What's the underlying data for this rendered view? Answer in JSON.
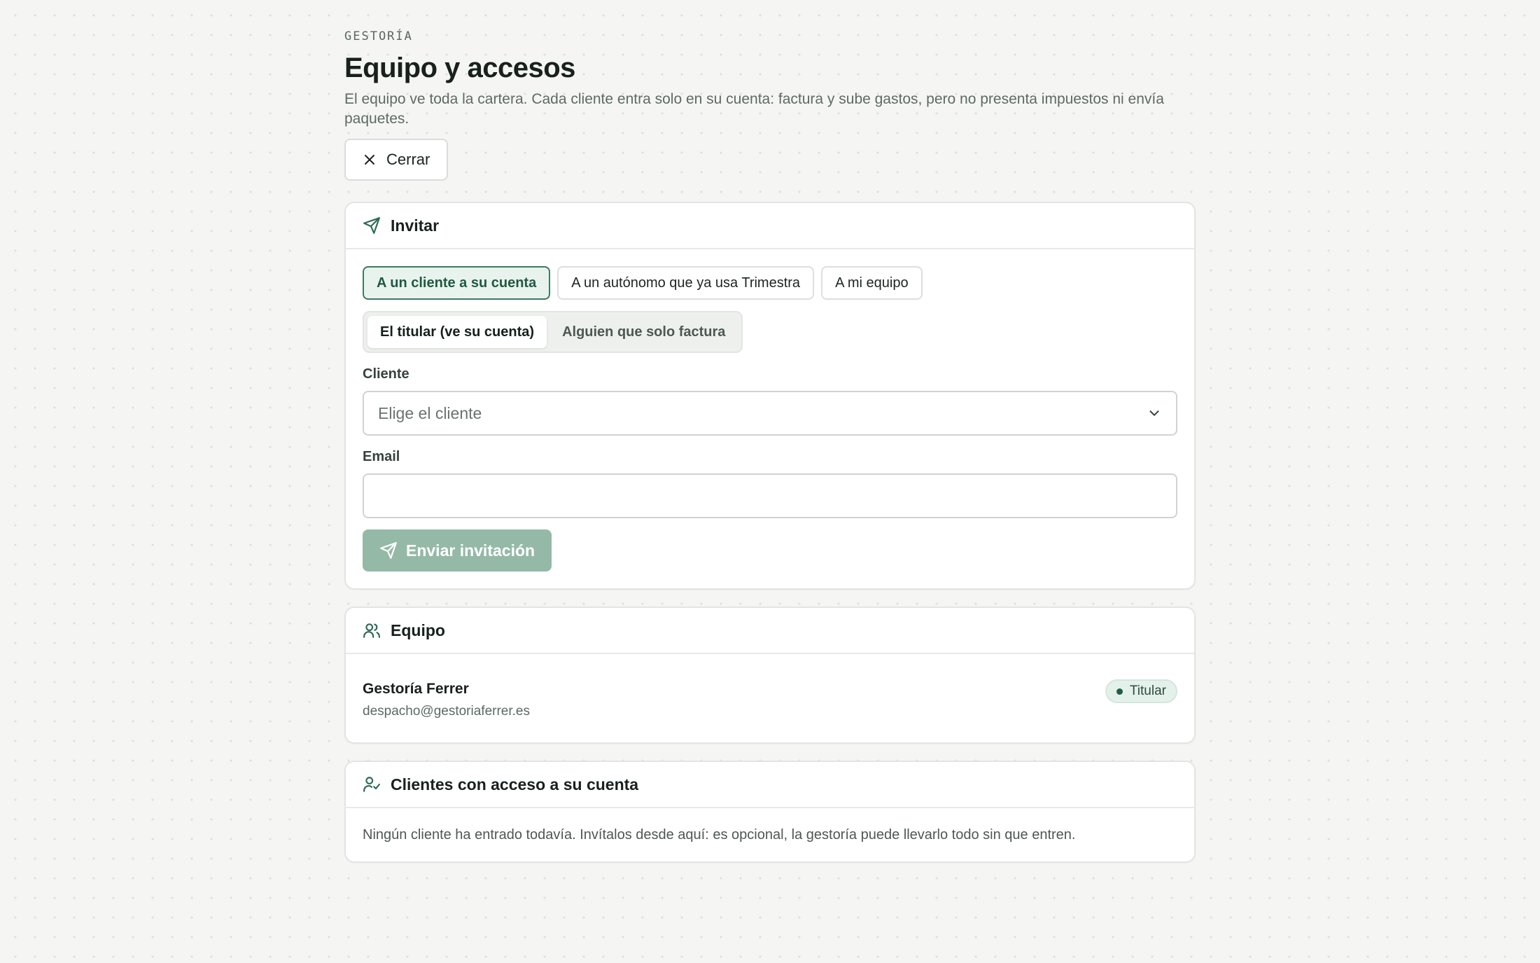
{
  "header": {
    "eyebrow": "GESTORÍA",
    "title": "Equipo y accesos",
    "subtitle": "El equipo ve toda la cartera. Cada cliente entra solo en su cuenta: factura y sube gastos, pero no presenta impuestos ni envía paquetes.",
    "close_label": "Cerrar"
  },
  "invite": {
    "title": "Invitar",
    "targets": [
      "A un cliente a su cuenta",
      "A un autónomo que ya usa Trimestra",
      "A mi equipo"
    ],
    "selected_target": "A un cliente a su cuenta",
    "roles": [
      "El titular (ve su cuenta)",
      "Alguien que solo factura"
    ],
    "selected_role": "El titular (ve su cuenta)",
    "client_label": "Cliente",
    "client_placeholder": "Elige el cliente",
    "email_label": "Email",
    "email_value": "",
    "send_label": "Enviar invitación"
  },
  "team": {
    "title": "Equipo",
    "members": [
      {
        "name": "Gestoría Ferrer",
        "email": "despacho@gestoriaferrer.es",
        "role": "Titular"
      }
    ]
  },
  "clients": {
    "title": "Clientes con acceso a su cuenta",
    "empty_text": "Ningún cliente ha entrado todavía. Invítalos desde aquí: es opcional, la gestoría puede llevarlo todo sin que entren."
  },
  "colors": {
    "accent": "#2f6b50",
    "accent_light": "#e9f3ee",
    "send_disabled": "#95b9a7"
  },
  "icons": {
    "close": "close-icon",
    "invite": "send-icon",
    "team": "users-icon",
    "clients": "user-check-icon",
    "dropdown": "chevron-down-icon"
  }
}
